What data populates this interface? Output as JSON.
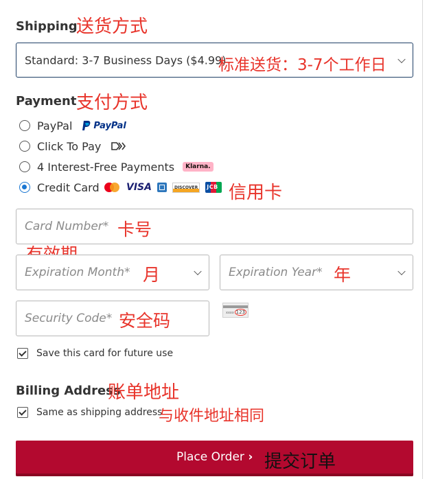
{
  "shipping": {
    "heading": "Shipping",
    "heading_note": "送货方式",
    "selected_option": "Standard: 3-7 Business Days ($4.99)",
    "selected_note": "标准送货：3-7个工作日"
  },
  "payment": {
    "heading": "Payment",
    "heading_note": "支付方式",
    "options": [
      {
        "label": "PayPal",
        "brand": "PayPal",
        "checked": false
      },
      {
        "label": "Click To Pay",
        "checked": false
      },
      {
        "label": "4 Interest-Free Payments",
        "brand": "Klarna.",
        "checked": false
      },
      {
        "label": "Credit Card",
        "checked": true,
        "note": "信用卡"
      }
    ],
    "card_brands": [
      "mastercard-icon",
      "VISA",
      "amex-icon",
      "DISCOVER",
      "JCB"
    ]
  },
  "card_form": {
    "card_number_placeholder": "Card Number*",
    "card_number_note": "卡号",
    "expiration_note": "有效期",
    "exp_month_placeholder": "Expiration Month*",
    "exp_month_note": "月",
    "exp_year_placeholder": "Expiration Year*",
    "exp_year_note": "年",
    "security_placeholder": "Security Code*",
    "security_note": "安全码",
    "cvv_sample": "123",
    "save_card_label": "Save this card for future use"
  },
  "billing": {
    "heading": "Billing Address",
    "heading_note": "账单地址",
    "same_as_shipping_label": "Same as shipping address",
    "same_as_shipping_note": "与收件地址相同"
  },
  "order": {
    "place_order_label": "Place Order",
    "place_order_note": "提交订单"
  },
  "colors": {
    "annotation": "#e8332a",
    "accent_blue": "#1976d2",
    "button": "#b3092f"
  }
}
